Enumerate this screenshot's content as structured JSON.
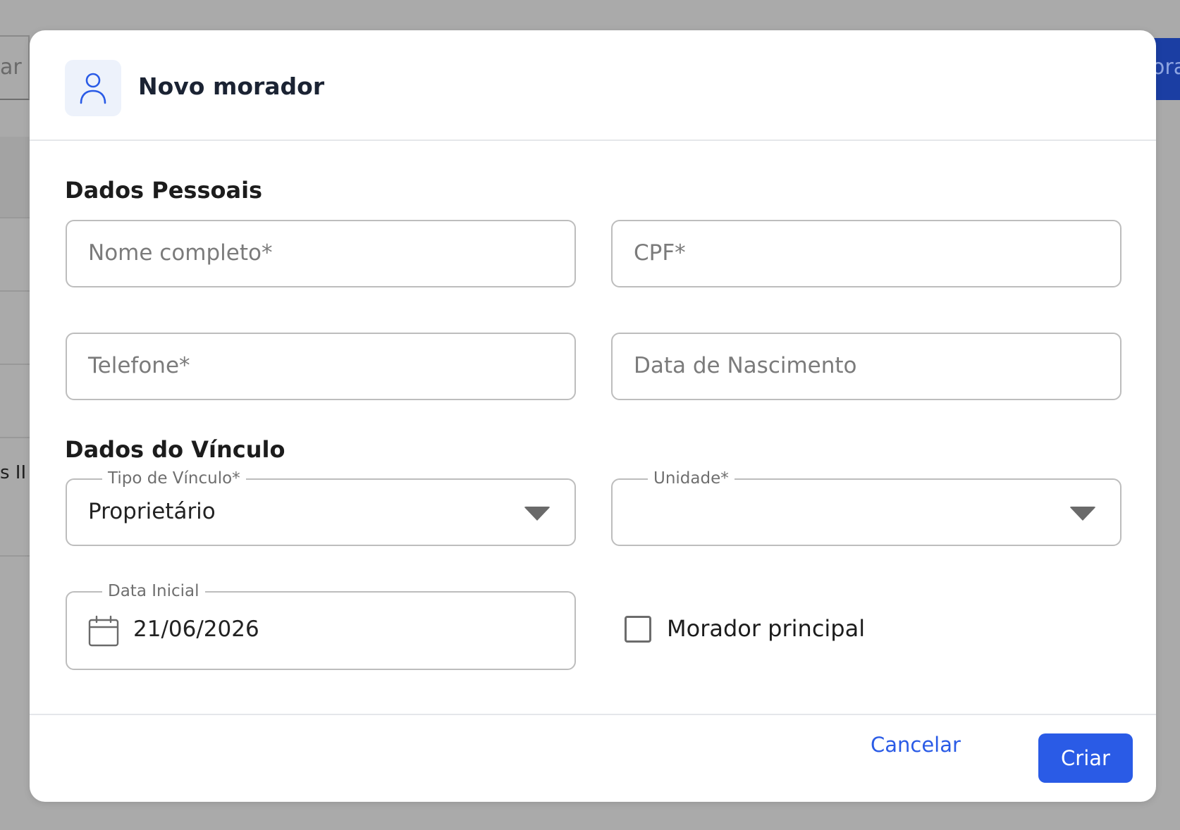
{
  "background": {
    "search_fragment": "ar",
    "right_button_fragment": "ora",
    "cell_fragment": "s II"
  },
  "dialog": {
    "title": "Novo morador",
    "icon": "user-icon",
    "sections": {
      "personal": {
        "title": "Dados Pessoais",
        "full_name_placeholder": "Nome completo*",
        "cpf_placeholder": "CPF*",
        "phone_placeholder": "Telefone*",
        "birth_date_placeholder": "Data de Nascimento"
      },
      "link": {
        "title": "Dados do Vínculo",
        "link_type_label": "Tipo de Vínculo*",
        "link_type_value": "Proprietário",
        "unit_label": "Unidade*",
        "unit_value": "",
        "start_date_label": "Data Inicial",
        "start_date_value": "21/06/2026",
        "main_resident_label": "Morador principal",
        "main_resident_checked": false
      }
    },
    "actions": {
      "cancel_label": "Cancelar",
      "create_label": "Criar"
    }
  },
  "colors": {
    "primary": "#2a5be6",
    "overlay": "#aaaaaa"
  }
}
